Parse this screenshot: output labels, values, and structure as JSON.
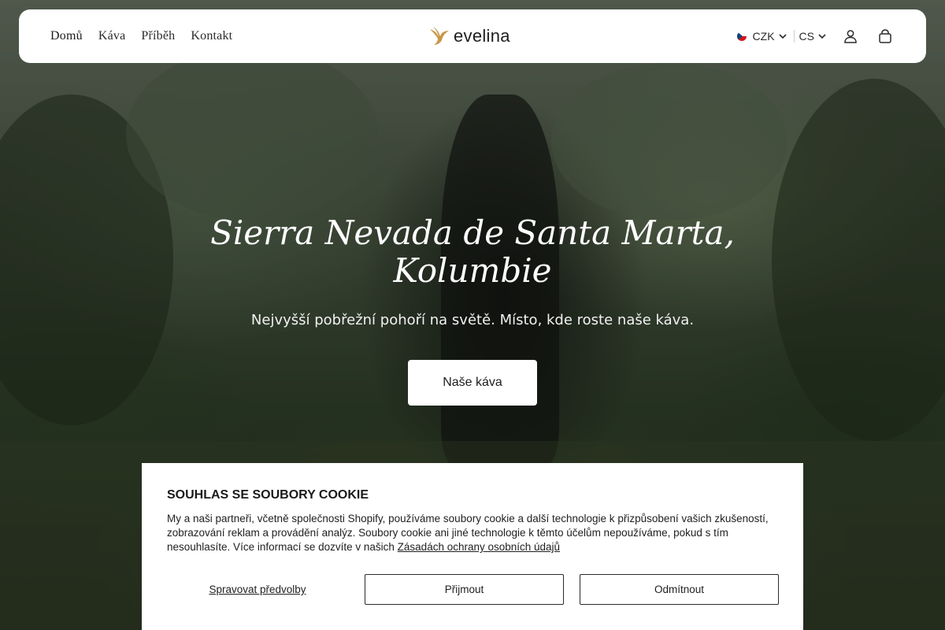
{
  "header": {
    "nav": [
      {
        "label": "Domů"
      },
      {
        "label": "Káva"
      },
      {
        "label": "Příběh"
      },
      {
        "label": "Kontakt"
      }
    ],
    "logo_text": "evelina",
    "logo_icon": "bird-icon",
    "currency": "CZK",
    "language": "CS",
    "account_icon": "user-icon",
    "cart_icon": "shopping-bag-icon",
    "flag_icon": "czech-flag-icon"
  },
  "hero": {
    "title_line1": "Sierra Nevada de Santa Marta,",
    "title_line2": "Kolumbie",
    "subtitle": "Nejvyšší pobřežní pohoří na světě. Místo, kde roste naše káva.",
    "cta": "Naše káva"
  },
  "cookie": {
    "title": "SOUHLAS SE SOUBORY COOKIE",
    "text": "My a naši partneři, včetně společnosti Shopify, používáme soubory cookie a další technologie k přizpůsobení vašich zkušeností, zobrazování reklam a provádění analýz. Soubory cookie ani jiné technologie k těmto účelům nepoužíváme, pokud s tím nesouhlasíte. Více informací se dozvíte v našich",
    "link": "Zásadách ochrany osobních údajů",
    "manage": "Spravovat předvolby",
    "accept": "Přijmout",
    "decline": "Odmítnout"
  },
  "colors": {
    "header_bg": "#ffffff",
    "logo_accent": "#c9974a",
    "text_dark": "#1f1f1f"
  }
}
